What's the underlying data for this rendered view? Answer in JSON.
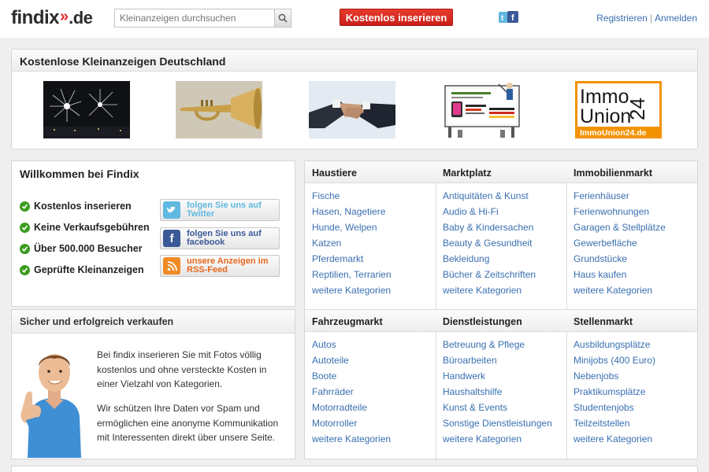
{
  "header": {
    "logo_main": "findix",
    "logo_chevrons": "»",
    "logo_tld": ".de",
    "search_placeholder": "Kleinanzeigen durchsuchen",
    "cta_label": "Kostenlos inserieren",
    "register_label": "Registrieren",
    "login_label": "Anmelden"
  },
  "showcase": {
    "title": "Kostenlose Kleinanzeigen Deutschland",
    "thumbs": [
      "fireworks",
      "trumpet",
      "handshake",
      "billboard",
      "immo-union-24"
    ],
    "immo_line1": "Immo",
    "immo_line2": "Union",
    "immo_num": "24",
    "immo_url": "ImmoUnion24.de"
  },
  "welcome": {
    "title": "Willkommen bei Findix",
    "features": [
      "Kostenlos inserieren",
      "Keine Verkaufsgebühren",
      "Über 500.000 Besucher",
      "Geprüfte Kleinanzeigen"
    ],
    "social": [
      {
        "line1": "folgen Sie uns auf",
        "line2": "Twitter",
        "color": "#5fb8e0"
      },
      {
        "line1": "folgen Sie uns auf",
        "line2": "facebook",
        "color": "#3b5998"
      },
      {
        "line1": "unsere Anzeigen im",
        "line2": "RSS-Feed",
        "color": "#f08a24"
      }
    ]
  },
  "sell": {
    "title": "Sicher und erfolgreich verkaufen",
    "para1": "Bei findix inserieren Sie mit Fotos völlig kostenlos und ohne versteckte Kosten in einer Vielzahl von Kategorien.",
    "para2": "Wir schützen Ihre Daten vor Spam und ermöglichen eine anonyme Kommunikation mit Interessenten direkt über unsere Seite."
  },
  "categories": [
    {
      "title": "Haustiere",
      "items": [
        "Fische",
        "Hasen, Nagetiere",
        "Hunde, Welpen",
        "Katzen",
        "Pferdemarkt",
        "Reptilien, Terrarien",
        "weitere Kategorien"
      ]
    },
    {
      "title": "Marktplatz",
      "items": [
        "Antiquitäten & Kunst",
        "Audio & Hi-Fi",
        "Baby & Kindersachen",
        "Beauty & Gesundheit",
        "Bekleidung",
        "Bücher & Zeitschriften",
        "weitere Kategorien"
      ]
    },
    {
      "title": "Immobilienmarkt",
      "items": [
        "Ferienhäuser",
        "Ferienwohnungen",
        "Garagen & Stellplätze",
        "Gewerbefläche",
        "Grundstücke",
        "Haus kaufen",
        "weitere Kategorien"
      ]
    },
    {
      "title": "Fahrzeugmarkt",
      "items": [
        "Autos",
        "Autoteile",
        "Boote",
        "Fahrräder",
        "Motorradteile",
        "Motorroller",
        "weitere Kategorien"
      ]
    },
    {
      "title": "Dienstleistungen",
      "items": [
        "Betreuung & Pflege",
        "Büroarbeiten",
        "Handwerk",
        "Haushaltshilfe",
        "Kunst & Events",
        "Sonstige Dienstleistungen",
        "weitere Kategorien"
      ]
    },
    {
      "title": "Stellenmarkt",
      "items": [
        "Ausbildungsplätze",
        "Minijobs (400 Euro)",
        "Nebenjobs",
        "Praktikumsplätze",
        "Studentenjobs",
        "Teilzeitstellen",
        "weitere Kategorien"
      ]
    }
  ]
}
